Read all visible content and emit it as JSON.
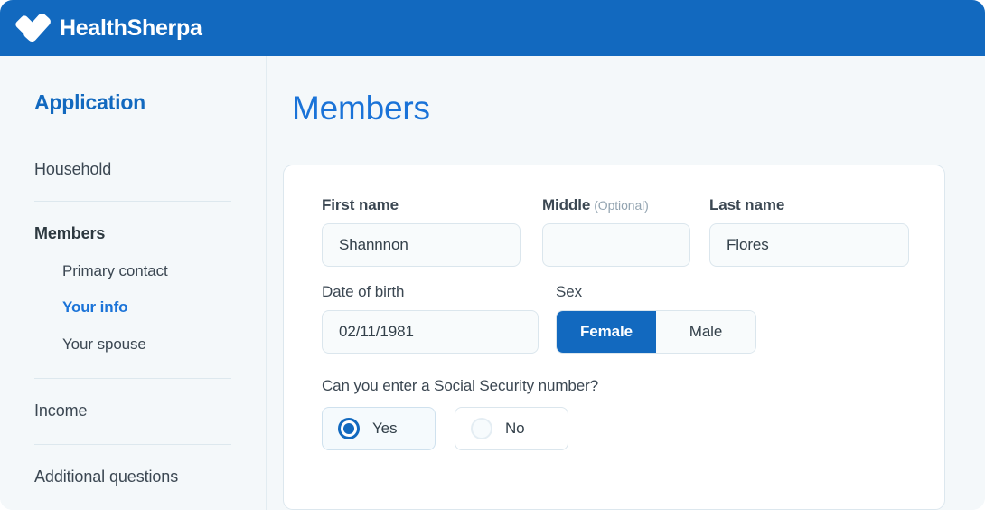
{
  "brand": {
    "name": "HealthSherpa",
    "logo_icon": "healthsherpa-heart-icon",
    "header_color": "#1269bf"
  },
  "sidebar": {
    "title": "Application",
    "items": [
      {
        "label": "Household",
        "level": "top",
        "active": false
      },
      {
        "label": "Members",
        "level": "top",
        "active": false,
        "bold": true
      },
      {
        "label": "Primary contact",
        "level": "sub",
        "active": false
      },
      {
        "label": "Your info",
        "level": "sub",
        "active": true
      },
      {
        "label": "Your spouse",
        "level": "sub",
        "active": false
      },
      {
        "label": "Income",
        "level": "top",
        "active": false
      },
      {
        "label": "Additional questions",
        "level": "top",
        "active": false
      }
    ]
  },
  "main": {
    "page_title": "Members",
    "form": {
      "first_name": {
        "label": "First name",
        "value": "Shannnon",
        "placeholder": ""
      },
      "middle_name": {
        "label": "Middle",
        "optional_tag": "(Optional)",
        "value": "",
        "placeholder": ""
      },
      "last_name": {
        "label": "Last name",
        "value": "Flores",
        "placeholder": ""
      },
      "date_of_birth": {
        "label": "Date of birth",
        "value": "02/11/1981",
        "placeholder": ""
      },
      "sex": {
        "label": "Sex",
        "options": [
          "Female",
          "Male"
        ],
        "selected": "Female"
      },
      "ssn_question": {
        "label": "Can you enter a Social Security number?",
        "options": [
          "Yes",
          "No"
        ],
        "selected": "Yes"
      }
    }
  },
  "colors": {
    "accent_blue": "#1269bf",
    "link_blue": "#1a73d8",
    "page_bg": "#f4f8fa",
    "card_bg": "#ffffff",
    "input_bg": "#f8fbfc",
    "border": "#dbe6ed"
  }
}
